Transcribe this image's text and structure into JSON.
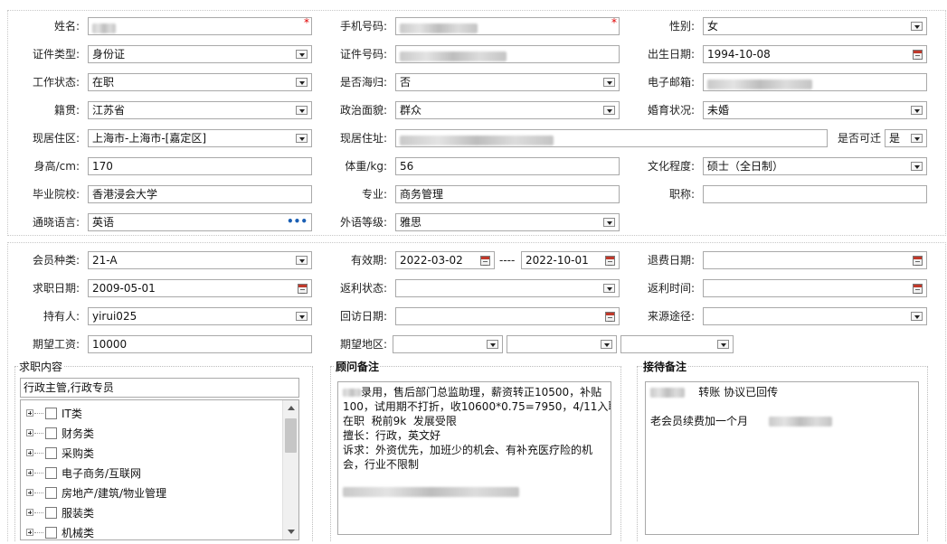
{
  "section1": {
    "name": {
      "label": "姓名:",
      "value_blurred": true
    },
    "phone": {
      "label": "手机号码:",
      "value_blurred": true
    },
    "gender": {
      "label": "性别:",
      "value": "女"
    },
    "id_type": {
      "label": "证件类型:",
      "value": "身份证"
    },
    "id_number": {
      "label": "证件号码:",
      "value_blurred": true
    },
    "birth_date": {
      "label": "出生日期:",
      "value": "1994-10-08"
    },
    "work_status": {
      "label": "工作状态:",
      "value": "在职"
    },
    "returnee": {
      "label": "是否海归:",
      "value": "否"
    },
    "email": {
      "label": "电子邮箱:",
      "value_blurred": true
    },
    "native_place": {
      "label": "籍贯:",
      "value": "江苏省"
    },
    "political": {
      "label": "政治面貌:",
      "value": "群众"
    },
    "marital": {
      "label": "婚育状况:",
      "value": "未婚"
    },
    "residence_area": {
      "label": "现居住区:",
      "value": "上海市-上海市-[嘉定区]"
    },
    "address": {
      "label": "现居住址:",
      "value_blurred": true
    },
    "relocate": {
      "label": "是否可迁",
      "value": "是"
    },
    "height": {
      "label": "身高/cm:",
      "value": "170"
    },
    "weight": {
      "label": "体重/kg:",
      "value": "56"
    },
    "education": {
      "label": "文化程度:",
      "value": "硕士（全日制）"
    },
    "school": {
      "label": "毕业院校:",
      "value": "香港浸会大学"
    },
    "major": {
      "label": "专业:",
      "value": "商务管理"
    },
    "title": {
      "label": "职称:",
      "value": ""
    },
    "language": {
      "label": "通晓语言:",
      "value": "英语"
    },
    "language_level": {
      "label": "外语等级:",
      "value": "雅思"
    }
  },
  "section2": {
    "member_type": {
      "label": "会员种类:",
      "value": "21-A"
    },
    "valid_period": {
      "label": "有效期:",
      "start": "2022-03-02",
      "separator": "----",
      "end": "2022-10-01"
    },
    "refund_date": {
      "label": "退费日期:",
      "value": ""
    },
    "job_date": {
      "label": "求职日期:",
      "value": "2009-05-01"
    },
    "rebate_status": {
      "label": "返利状态:",
      "value": ""
    },
    "rebate_time": {
      "label": "返利时间:",
      "value": ""
    },
    "holder": {
      "label": "持有人:",
      "value": "yirui025"
    },
    "visit_date": {
      "label": "回访日期:",
      "value": ""
    },
    "source": {
      "label": "来源途径:",
      "value": ""
    },
    "expected_salary": {
      "label": "期望工资:",
      "value": "10000"
    },
    "expected_area": {
      "label": "期望地区:",
      "values": [
        "",
        "",
        ""
      ]
    }
  },
  "job_content": {
    "title": "求职内容",
    "summary": "行政主管,行政专员",
    "tree": [
      "IT类",
      "财务类",
      "采购类",
      "电子商务/互联网",
      "房地产/建筑/物业管理",
      "服装类",
      "机械类"
    ]
  },
  "advisor_notes": {
    "title": "顾问备注",
    "lines": [
      "录用，售后部门总监助理，薪资转正10500，补贴",
      "100，试用期不打折，收10600*0.75=7950，4/11入职",
      "",
      "在职  税前9k  发展受限",
      "擅长：行政，英文好",
      "诉求：外资优先，加班少的机会、有补充医疗险的机",
      "会，行业不限制"
    ]
  },
  "reception_notes": {
    "title": "接待备注",
    "line1": "转账 协议已回传",
    "line2": "老会员续费加一个月"
  },
  "icons": {
    "dropdown": "dropdown-arrow-icon",
    "calendar": "calendar-icon",
    "more": "ellipsis-icon"
  }
}
